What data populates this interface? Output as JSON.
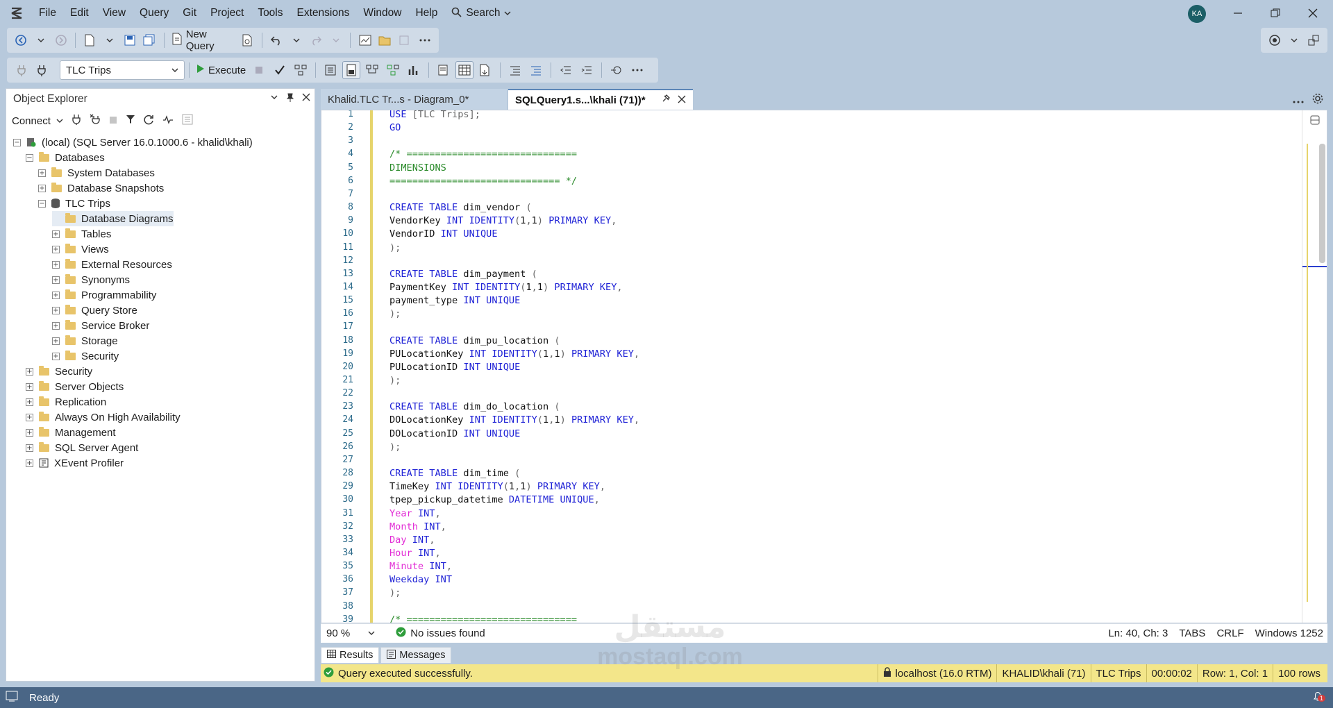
{
  "menu": [
    "File",
    "Edit",
    "View",
    "Query",
    "Git",
    "Project",
    "Tools",
    "Extensions",
    "Window",
    "Help"
  ],
  "search_label": "Search",
  "user_initials": "KA",
  "toolbar": {
    "new_query_label": "New Query",
    "database_selected": "TLC Trips",
    "execute_label": "Execute"
  },
  "object_explorer": {
    "title": "Object Explorer",
    "connect_label": "Connect",
    "tree": [
      {
        "label": "(local) (SQL Server 16.0.1000.6 - khalid\\khali)",
        "level": 0,
        "expander": "-",
        "icon": "server"
      },
      {
        "label": "Databases",
        "level": 1,
        "expander": "-",
        "icon": "folder"
      },
      {
        "label": "System Databases",
        "level": 2,
        "expander": "+",
        "icon": "folder"
      },
      {
        "label": "Database Snapshots",
        "level": 2,
        "expander": "+",
        "icon": "folder"
      },
      {
        "label": "TLC Trips",
        "level": 2,
        "expander": "-",
        "icon": "database"
      },
      {
        "label": "Database Diagrams",
        "level": 3,
        "expander": "",
        "icon": "folder",
        "selected": true
      },
      {
        "label": "Tables",
        "level": 3,
        "expander": "+",
        "icon": "folder"
      },
      {
        "label": "Views",
        "level": 3,
        "expander": "+",
        "icon": "folder"
      },
      {
        "label": "External Resources",
        "level": 3,
        "expander": "+",
        "icon": "folder"
      },
      {
        "label": "Synonyms",
        "level": 3,
        "expander": "+",
        "icon": "folder"
      },
      {
        "label": "Programmability",
        "level": 3,
        "expander": "+",
        "icon": "folder"
      },
      {
        "label": "Query Store",
        "level": 3,
        "expander": "+",
        "icon": "folder"
      },
      {
        "label": "Service Broker",
        "level": 3,
        "expander": "+",
        "icon": "folder"
      },
      {
        "label": "Storage",
        "level": 3,
        "expander": "+",
        "icon": "folder"
      },
      {
        "label": "Security",
        "level": 3,
        "expander": "+",
        "icon": "folder"
      },
      {
        "label": "Security",
        "level": 1,
        "expander": "+",
        "icon": "folder"
      },
      {
        "label": "Server Objects",
        "level": 1,
        "expander": "+",
        "icon": "folder"
      },
      {
        "label": "Replication",
        "level": 1,
        "expander": "+",
        "icon": "folder"
      },
      {
        "label": "Always On High Availability",
        "level": 1,
        "expander": "+",
        "icon": "folder"
      },
      {
        "label": "Management",
        "level": 1,
        "expander": "+",
        "icon": "folder"
      },
      {
        "label": "SQL Server Agent",
        "level": 1,
        "expander": "+",
        "icon": "folder"
      },
      {
        "label": "XEvent Profiler",
        "level": 1,
        "expander": "+",
        "icon": "profiler"
      }
    ]
  },
  "tabs": [
    {
      "label": "Khalid.TLC Tr...s - Diagram_0*",
      "active": false
    },
    {
      "label": "SQLQuery1.s...\\khali (71))*",
      "active": true
    }
  ],
  "editor": {
    "lines": [
      [
        [
          "kw",
          "USE"
        ],
        [
          "",
          " "
        ],
        [
          "gy",
          "[TLC Trips]"
        ],
        [
          "gy",
          ";"
        ]
      ],
      [
        [
          "kw",
          "GO"
        ]
      ],
      [],
      [
        [
          "cm",
          "/* =============================="
        ]
      ],
      [
        [
          "cm",
          "DIMENSIONS"
        ]
      ],
      [
        [
          "cm",
          "============================== */"
        ]
      ],
      [],
      [
        [
          "kw",
          "CREATE"
        ],
        [
          "",
          " "
        ],
        [
          "kw",
          "TABLE"
        ],
        [
          "",
          " dim_vendor "
        ],
        [
          "gy",
          "("
        ]
      ],
      [
        [
          "",
          "VendorKey "
        ],
        [
          "kw",
          "INT"
        ],
        [
          "",
          " "
        ],
        [
          "kw",
          "IDENTITY"
        ],
        [
          "gy",
          "("
        ],
        [
          "",
          "1"
        ],
        [
          "gy",
          ","
        ],
        [
          "",
          "1"
        ],
        [
          "gy",
          ")"
        ],
        [
          "",
          " "
        ],
        [
          "kw",
          "PRIMARY KEY"
        ],
        [
          "gy",
          ","
        ]
      ],
      [
        [
          "",
          "VendorID "
        ],
        [
          "kw",
          "INT"
        ],
        [
          "",
          " "
        ],
        [
          "kw",
          "UNIQUE"
        ]
      ],
      [
        [
          "gy",
          ");"
        ]
      ],
      [],
      [
        [
          "kw",
          "CREATE"
        ],
        [
          "",
          " "
        ],
        [
          "kw",
          "TABLE"
        ],
        [
          "",
          " dim_payment "
        ],
        [
          "gy",
          "("
        ]
      ],
      [
        [
          "",
          "PaymentKey "
        ],
        [
          "kw",
          "INT"
        ],
        [
          "",
          " "
        ],
        [
          "kw",
          "IDENTITY"
        ],
        [
          "gy",
          "("
        ],
        [
          "",
          "1"
        ],
        [
          "gy",
          ","
        ],
        [
          "",
          "1"
        ],
        [
          "gy",
          ")"
        ],
        [
          "",
          " "
        ],
        [
          "kw",
          "PRIMARY KEY"
        ],
        [
          "gy",
          ","
        ]
      ],
      [
        [
          "",
          "payment_type "
        ],
        [
          "kw",
          "INT"
        ],
        [
          "",
          " "
        ],
        [
          "kw",
          "UNIQUE"
        ]
      ],
      [
        [
          "gy",
          ");"
        ]
      ],
      [],
      [
        [
          "kw",
          "CREATE"
        ],
        [
          "",
          " "
        ],
        [
          "kw",
          "TABLE"
        ],
        [
          "",
          " dim_pu_location "
        ],
        [
          "gy",
          "("
        ]
      ],
      [
        [
          "",
          "PULocationKey "
        ],
        [
          "kw",
          "INT"
        ],
        [
          "",
          " "
        ],
        [
          "kw",
          "IDENTITY"
        ],
        [
          "gy",
          "("
        ],
        [
          "",
          "1"
        ],
        [
          "gy",
          ","
        ],
        [
          "",
          "1"
        ],
        [
          "gy",
          ")"
        ],
        [
          "",
          " "
        ],
        [
          "kw",
          "PRIMARY KEY"
        ],
        [
          "gy",
          ","
        ]
      ],
      [
        [
          "",
          "PULocationID "
        ],
        [
          "kw",
          "INT"
        ],
        [
          "",
          " "
        ],
        [
          "kw",
          "UNIQUE"
        ]
      ],
      [
        [
          "gy",
          ");"
        ]
      ],
      [],
      [
        [
          "kw",
          "CREATE"
        ],
        [
          "",
          " "
        ],
        [
          "kw",
          "TABLE"
        ],
        [
          "",
          " dim_do_location "
        ],
        [
          "gy",
          "("
        ]
      ],
      [
        [
          "",
          "DOLocationKey "
        ],
        [
          "kw",
          "INT"
        ],
        [
          "",
          " "
        ],
        [
          "kw",
          "IDENTITY"
        ],
        [
          "gy",
          "("
        ],
        [
          "",
          "1"
        ],
        [
          "gy",
          ","
        ],
        [
          "",
          "1"
        ],
        [
          "gy",
          ")"
        ],
        [
          "",
          " "
        ],
        [
          "kw",
          "PRIMARY KEY"
        ],
        [
          "gy",
          ","
        ]
      ],
      [
        [
          "",
          "DOLocationID "
        ],
        [
          "kw",
          "INT"
        ],
        [
          "",
          " "
        ],
        [
          "kw",
          "UNIQUE"
        ]
      ],
      [
        [
          "gy",
          ");"
        ]
      ],
      [],
      [
        [
          "kw",
          "CREATE"
        ],
        [
          "",
          " "
        ],
        [
          "kw",
          "TABLE"
        ],
        [
          "",
          " dim_time "
        ],
        [
          "gy",
          "("
        ]
      ],
      [
        [
          "",
          "TimeKey "
        ],
        [
          "kw",
          "INT"
        ],
        [
          "",
          " "
        ],
        [
          "kw",
          "IDENTITY"
        ],
        [
          "gy",
          "("
        ],
        [
          "",
          "1"
        ],
        [
          "gy",
          ","
        ],
        [
          "",
          "1"
        ],
        [
          "gy",
          ")"
        ],
        [
          "",
          " "
        ],
        [
          "kw",
          "PRIMARY KEY"
        ],
        [
          "gy",
          ","
        ]
      ],
      [
        [
          "",
          "tpep_pickup_datetime "
        ],
        [
          "kw",
          "DATETIME"
        ],
        [
          "",
          " "
        ],
        [
          "kw",
          "UNIQUE"
        ],
        [
          "gy",
          ","
        ]
      ],
      [
        [
          "fn",
          "Year"
        ],
        [
          "",
          " "
        ],
        [
          "kw",
          "INT"
        ],
        [
          "gy",
          ","
        ]
      ],
      [
        [
          "fn",
          "Month"
        ],
        [
          "",
          " "
        ],
        [
          "kw",
          "INT"
        ],
        [
          "gy",
          ","
        ]
      ],
      [
        [
          "fn",
          "Day"
        ],
        [
          "",
          " "
        ],
        [
          "kw",
          "INT"
        ],
        [
          "gy",
          ","
        ]
      ],
      [
        [
          "fn",
          "Hour"
        ],
        [
          "",
          " "
        ],
        [
          "kw",
          "INT"
        ],
        [
          "gy",
          ","
        ]
      ],
      [
        [
          "fn",
          "Minute"
        ],
        [
          "",
          " "
        ],
        [
          "kw",
          "INT"
        ],
        [
          "gy",
          ","
        ]
      ],
      [
        [
          "kw",
          "Weekday"
        ],
        [
          "",
          " "
        ],
        [
          "kw",
          "INT"
        ]
      ],
      [
        [
          "gy",
          ");"
        ]
      ],
      [],
      [
        [
          "cm",
          "/* =============================="
        ]
      ]
    ]
  },
  "editor_status": {
    "zoom": "90 %",
    "issues": "No issues found",
    "position": "Ln: 40, Ch: 3",
    "tabs": "TABS",
    "eol": "CRLF",
    "encoding": "Windows 1252"
  },
  "results_tabs": [
    "Results",
    "Messages"
  ],
  "query_status": {
    "message": "Query executed successfully.",
    "server": "localhost (16.0 RTM)",
    "user": "KHALID\\khali (71)",
    "database": "TLC Trips",
    "elapsed": "00:00:02",
    "rowcol": "Row: 1, Col: 1",
    "rows": "100 rows"
  },
  "status_bar": {
    "text": "Ready",
    "notification_count": "1"
  },
  "watermark": [
    "مستقل",
    "mostaql.com"
  ]
}
